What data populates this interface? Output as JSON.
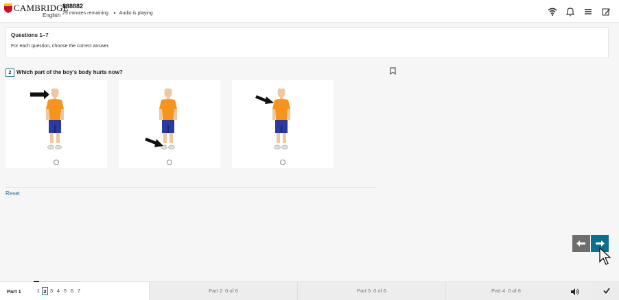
{
  "header": {
    "logo_text": "CAMBRIDGE",
    "logo_sub": "English",
    "candidate_id": "888882",
    "time_remaining": "29 minutes remaining",
    "audio_status": "Audio is playing",
    "icons": [
      "wifi-icon",
      "bell-icon",
      "menu-icon",
      "edit-icon"
    ]
  },
  "questions_panel": {
    "title": "Questions 1–7",
    "instruction": "For each question, choose the correct answer."
  },
  "question": {
    "number": "2",
    "text": "Which part of the boy’s body hurts now?",
    "options": [
      {
        "arrow_target": "head"
      },
      {
        "arrow_target": "foot"
      },
      {
        "arrow_target": "shoulder"
      }
    ]
  },
  "reset_label": "Reset",
  "colors": {
    "accent": "#0c6f8f",
    "shirt": "#f7941d",
    "shorts": "#2b3aa0",
    "prev_button": "#6e6e6e"
  },
  "footer": {
    "part1_label": "Part 1",
    "part1_questions": [
      "1",
      "2",
      "3",
      "4",
      "5",
      "6",
      "7"
    ],
    "current_question": "2",
    "parts": [
      {
        "label": "Part 2",
        "count": "0 of 6"
      },
      {
        "label": "Part 3",
        "count": "0 of 6"
      },
      {
        "label": "Part 4",
        "count": "0 of 6"
      }
    ]
  }
}
